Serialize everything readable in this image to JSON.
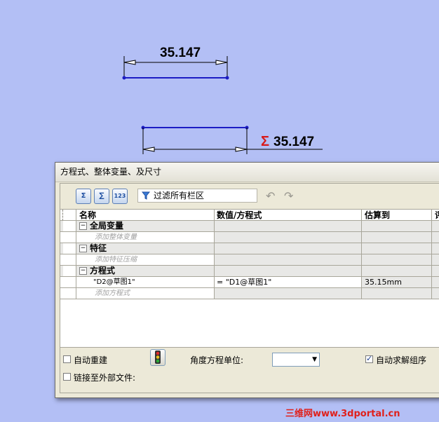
{
  "sketch": {
    "dimension_top": "35.147",
    "dimension_equation": "35.147",
    "equation_symbol": "Σ"
  },
  "dialog": {
    "title": "方程式、整体变量、及尺寸",
    "toolbar": {
      "button1": "Σ",
      "button2": "∑",
      "button3": "123",
      "filter_text": "过滤所有栏区",
      "undo_icon": "undo-icon",
      "redo_icon": "redo-icon"
    },
    "columns": [
      "名称",
      "数值/方程式",
      "估算到",
      "评"
    ],
    "groups": {
      "global": {
        "label": "全局变量",
        "add_placeholder": "添加整体变量",
        "expander": "⊟"
      },
      "features": {
        "label": "特征",
        "add_placeholder": "添加特征压缩",
        "expander": "⊟"
      },
      "equations": {
        "label": "方程式",
        "expander": "⊟",
        "rows": [
          {
            "name": "\"D2@草图1\"",
            "value": "= \"D1@草图1\"",
            "estimate": "35.15mm"
          }
        ],
        "add_placeholder": "添加方程式"
      }
    },
    "footer": {
      "auto_rebuild": {
        "label": "自动重建",
        "checked": false
      },
      "link_external": {
        "label": "链接至外部文件:",
        "checked": false
      },
      "angle_unit_label": "角度方程单位:",
      "angle_unit_value": "",
      "auto_solve": {
        "label": "自动求解组序",
        "checked": true
      }
    }
  },
  "watermark": "三维网www.3dportal.cn",
  "colors": {
    "background": "#b3bff5",
    "sketch_line": "#1c1cc4",
    "sigma": "#d81b1b",
    "watermark": "#e0201b"
  }
}
